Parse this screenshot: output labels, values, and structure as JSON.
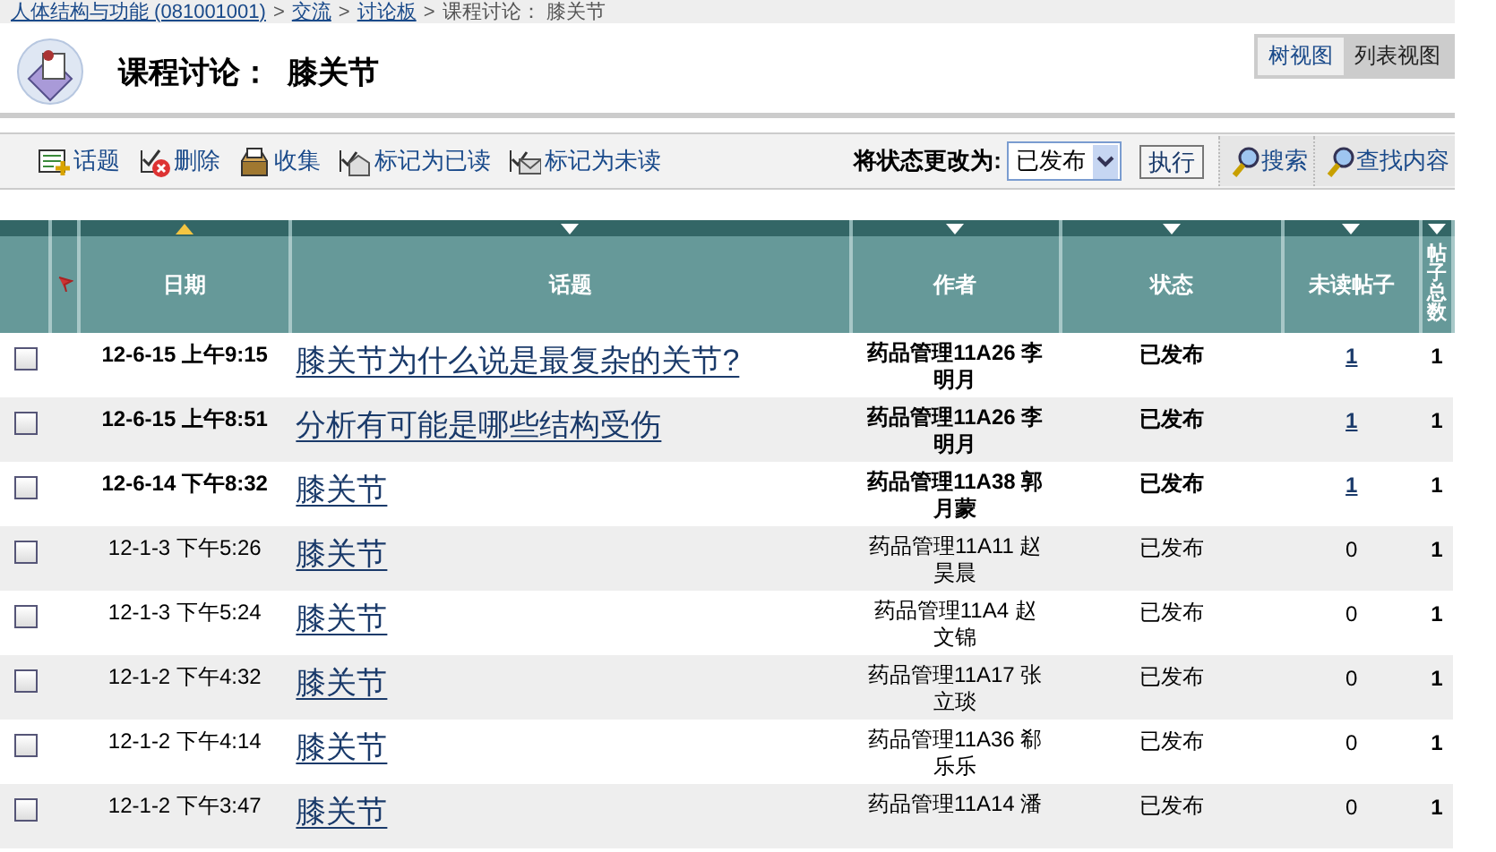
{
  "breadcrumb": [
    {
      "label": "人体结构与功能 (081001001)",
      "link": true
    },
    {
      "label": "交流",
      "link": true
    },
    {
      "label": "讨论板",
      "link": true
    },
    {
      "label": "课程讨论： 膝关节",
      "link": false
    }
  ],
  "breadcrumb_separator": ">",
  "page_title": "课程讨论：  膝关节",
  "views": [
    {
      "label": "树视图",
      "selected": false
    },
    {
      "label": "列表视图",
      "selected": true
    }
  ],
  "toolbar": {
    "actions": [
      {
        "label": "话题",
        "kind": "add"
      },
      {
        "label": "删除",
        "kind": "delete"
      },
      {
        "label": "收集",
        "kind": "collect"
      },
      {
        "label": "标记为已读",
        "kind": "read"
      },
      {
        "label": "标记为未读",
        "kind": "unread"
      }
    ],
    "status_label": "将状态更改为:",
    "status_value": "已发布",
    "execute": "执行",
    "search": "搜索",
    "find": "查找内容"
  },
  "table": {
    "columns": [
      {
        "kind": "select"
      },
      {
        "kind": "flag"
      },
      {
        "label": "日期",
        "sort_ascending": true
      },
      {
        "label": "话题",
        "sort_ascending": false
      },
      {
        "label": "作者",
        "sort_ascending": false
      },
      {
        "label": "状态",
        "sort_ascending": false
      },
      {
        "label": "未读帖子",
        "sort_ascending": false
      },
      {
        "label": "帖子总数",
        "sort_ascending": false
      }
    ],
    "rows": [
      {
        "checked": false,
        "unread": true,
        "date": "12-6-15 上午9:15",
        "topic": "膝关节为什么说是最复杂的关节?",
        "author": "药品管理11A26 李明月",
        "status": "已发布",
        "unread_count": "1",
        "total": "1"
      },
      {
        "checked": false,
        "unread": true,
        "date": "12-6-15 上午8:51",
        "topic": "分析有可能是哪些结构受伤",
        "author": "药品管理11A26 李明月",
        "status": "已发布",
        "unread_count": "1",
        "total": "1"
      },
      {
        "checked": false,
        "unread": true,
        "date": "12-6-14 下午8:32",
        "topic": "膝关节",
        "author": "药品管理11A38 郭月蒙",
        "status": "已发布",
        "unread_count": "1",
        "total": "1"
      },
      {
        "checked": false,
        "unread": false,
        "date": "12-1-3 下午5:26",
        "topic": "膝关节",
        "author": "药品管理11A11 赵昊晨",
        "status": "已发布",
        "unread_count": "0",
        "total": "1"
      },
      {
        "checked": false,
        "unread": false,
        "date": "12-1-3 下午5:24",
        "topic": "膝关节",
        "author": "药品管理11A4 赵文锦",
        "status": "已发布",
        "unread_count": "0",
        "total": "1"
      },
      {
        "checked": false,
        "unread": false,
        "date": "12-1-2 下午4:32",
        "topic": "膝关节",
        "author": "药品管理11A17 张立琰",
        "status": "已发布",
        "unread_count": "0",
        "total": "1"
      },
      {
        "checked": false,
        "unread": false,
        "date": "12-1-2 下午4:14",
        "topic": "膝关节",
        "author": "药品管理11A36 郗乐乐",
        "status": "已发布",
        "unread_count": "0",
        "total": "1"
      },
      {
        "checked": false,
        "unread": false,
        "date": "12-1-2 下午3:47",
        "topic": "膝关节",
        "author": "药品管理11A14 潘",
        "status": "已发布",
        "unread_count": "0",
        "total": "1"
      }
    ]
  }
}
